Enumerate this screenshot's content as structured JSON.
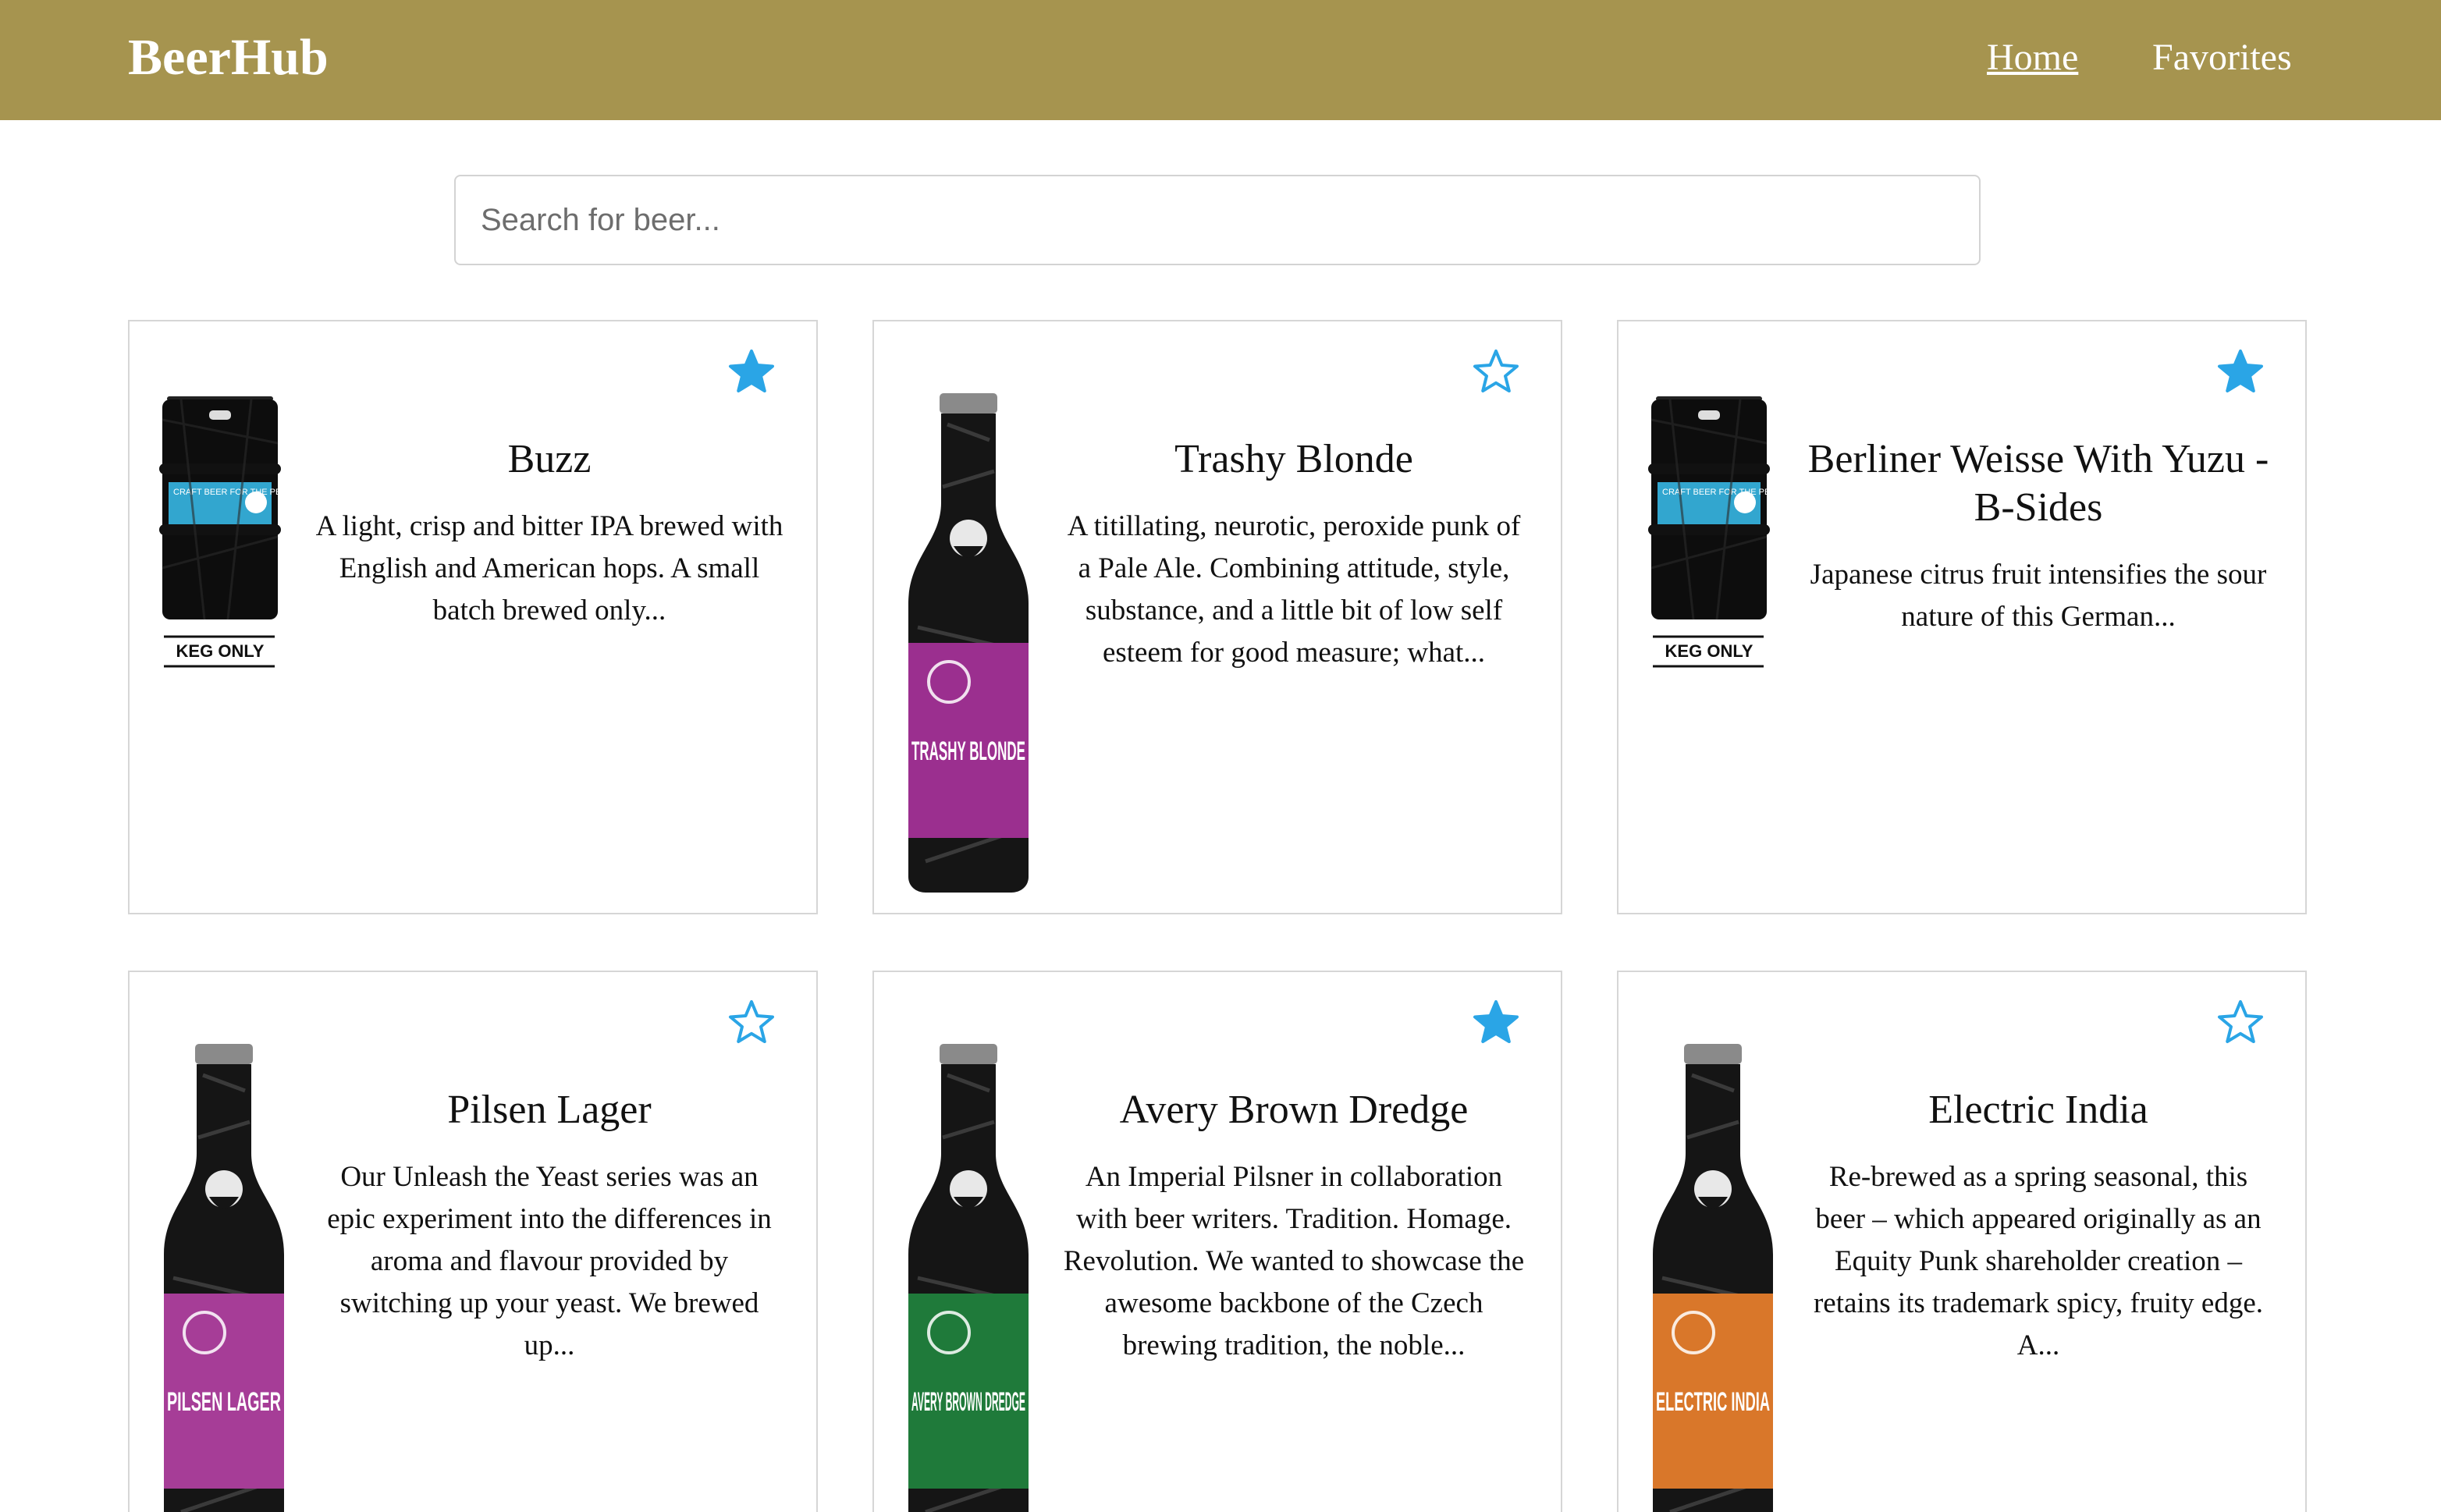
{
  "nav": {
    "brand": "BeerHub",
    "links": [
      {
        "label": "Home",
        "active": true
      },
      {
        "label": "Favorites",
        "active": false
      }
    ]
  },
  "search": {
    "placeholder": "Search for beer...",
    "value": ""
  },
  "colors": {
    "navbar": "#a6944f",
    "star": "#2aa5e6"
  },
  "beers": [
    {
      "name": "Buzz",
      "description": "A light, crisp and bitter IPA brewed with English and American hops. A small batch brewed only...",
      "favorite": true,
      "image": "keg",
      "keg_label": "KEG ONLY",
      "label_text": "CRAFT BEER FOR THE PEOPLE"
    },
    {
      "name": "Trashy Blonde",
      "description": "A titillating, neurotic, peroxide punk of a Pale Ale. Combining attitude, style, substance, and a little bit of low self esteem for good measure; what...",
      "favorite": false,
      "image": "bottle",
      "label_color": "#9b2f8f",
      "label_text": "TRASHY BLONDE"
    },
    {
      "name": "Berliner Weisse With Yuzu - B-Sides",
      "description": "Japanese citrus fruit intensifies the sour nature of this German...",
      "favorite": true,
      "image": "keg",
      "keg_label": "KEG ONLY",
      "label_text": "CRAFT BEER FOR THE PEOPLE"
    },
    {
      "name": "Pilsen Lager",
      "description": "Our Unleash the Yeast series was an epic experiment into the differences in aroma and flavour provided by switching up your yeast. We brewed up...",
      "favorite": false,
      "image": "bottle",
      "label_color": "#a63d97",
      "label_text": "PILSEN LAGER"
    },
    {
      "name": "Avery Brown Dredge",
      "description": "An Imperial Pilsner in collaboration with beer writers. Tradition. Homage. Revolution. We wanted to showcase the awesome backbone of the Czech brewing tradition, the noble...",
      "favorite": true,
      "image": "bottle",
      "label_color": "#1f7a3a",
      "label_text": "AVERY BROWN DREDGE"
    },
    {
      "name": "Electric India",
      "description": "Re-brewed as a spring seasonal, this beer – which appeared originally as an Equity Punk shareholder creation – retains its trademark spicy, fruity edge. A...",
      "favorite": false,
      "image": "bottle",
      "label_color": "#d9772a",
      "label_text": "ELECTRIC INDIA"
    }
  ]
}
